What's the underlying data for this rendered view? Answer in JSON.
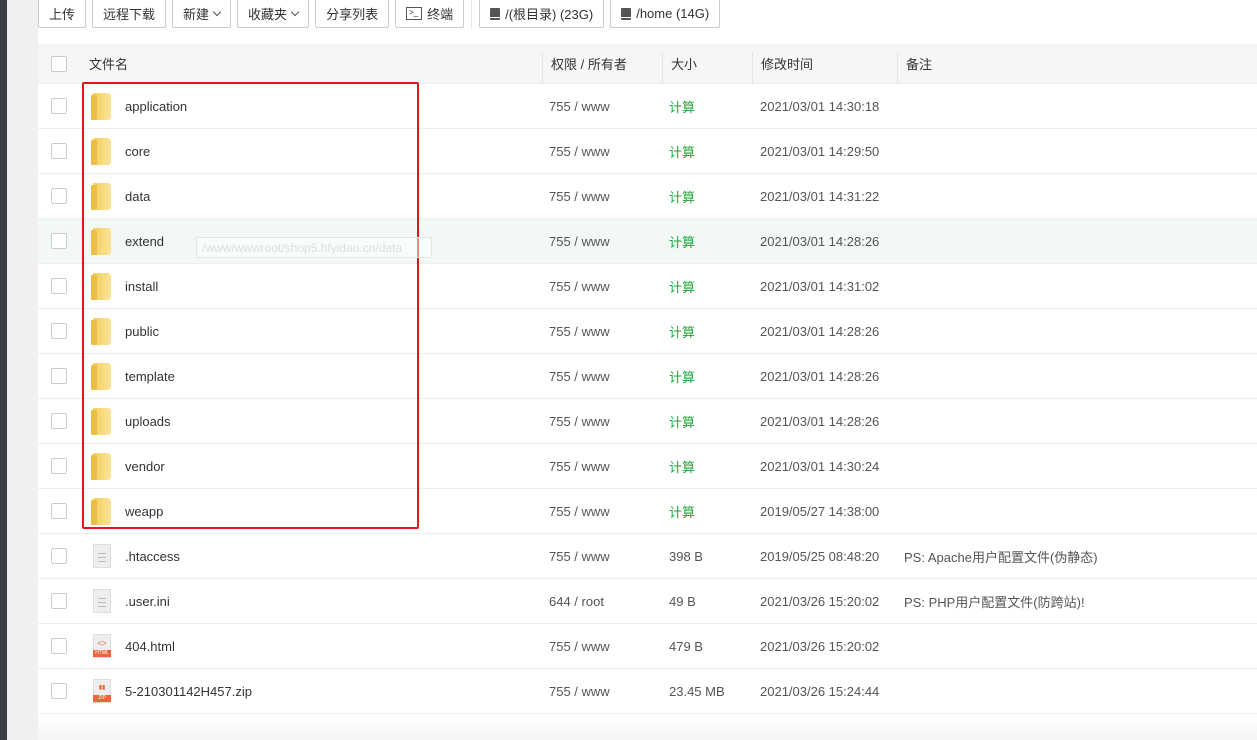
{
  "toolbar": {
    "upload": "上传",
    "remote_download": "远程下载",
    "new": "新建",
    "favorites": "收藏夹",
    "share_list": "分享列表",
    "terminal": "终端",
    "disk_root": "/(根目录) (23G)",
    "disk_home": "/home (14G)"
  },
  "columns": {
    "name": "文件名",
    "perm": "权限 / 所有者",
    "size": "大小",
    "mtime": "修改时间",
    "note": "备注"
  },
  "tooltip": "/www/wwwroot/shop5.hfyidao.cn/data",
  "rows": [
    {
      "name": "application",
      "type": "folder",
      "perm": "755 / www",
      "size": "计算",
      "mtime": "2021/03/01 14:30:18",
      "note": ""
    },
    {
      "name": "core",
      "type": "folder",
      "perm": "755 / www",
      "size": "计算",
      "mtime": "2021/03/01 14:29:50",
      "note": ""
    },
    {
      "name": "data",
      "type": "folder",
      "perm": "755 / www",
      "size": "计算",
      "mtime": "2021/03/01 14:31:22",
      "note": ""
    },
    {
      "name": "extend",
      "type": "folder",
      "perm": "755 / www",
      "size": "计算",
      "mtime": "2021/03/01 14:28:26",
      "note": ""
    },
    {
      "name": "install",
      "type": "folder",
      "perm": "755 / www",
      "size": "计算",
      "mtime": "2021/03/01 14:31:02",
      "note": ""
    },
    {
      "name": "public",
      "type": "folder",
      "perm": "755 / www",
      "size": "计算",
      "mtime": "2021/03/01 14:28:26",
      "note": ""
    },
    {
      "name": "template",
      "type": "folder",
      "perm": "755 / www",
      "size": "计算",
      "mtime": "2021/03/01 14:28:26",
      "note": ""
    },
    {
      "name": "uploads",
      "type": "folder",
      "perm": "755 / www",
      "size": "计算",
      "mtime": "2021/03/01 14:28:26",
      "note": ""
    },
    {
      "name": "vendor",
      "type": "folder",
      "perm": "755 / www",
      "size": "计算",
      "mtime": "2021/03/01 14:30:24",
      "note": ""
    },
    {
      "name": "weapp",
      "type": "folder",
      "perm": "755 / www",
      "size": "计算",
      "mtime": "2019/05/27 14:38:00",
      "note": ""
    },
    {
      "name": ".htaccess",
      "type": "text",
      "perm": "755 / www",
      "size": "398 B",
      "mtime": "2019/05/25 08:48:20",
      "note": "PS: Apache用户配置文件(伪静态)"
    },
    {
      "name": ".user.ini",
      "type": "text",
      "perm": "644 / root",
      "size": "49 B",
      "mtime": "2021/03/26 15:20:02",
      "note": "PS: PHP用户配置文件(防跨站)!"
    },
    {
      "name": "404.html",
      "type": "html",
      "perm": "755 / www",
      "size": "479 B",
      "mtime": "2021/03/26 15:20:02",
      "note": ""
    },
    {
      "name": "5-210301142H457.zip",
      "type": "zip",
      "perm": "755 / www",
      "size": "23.45 MB",
      "mtime": "2021/03/26 15:24:44",
      "note": ""
    }
  ]
}
